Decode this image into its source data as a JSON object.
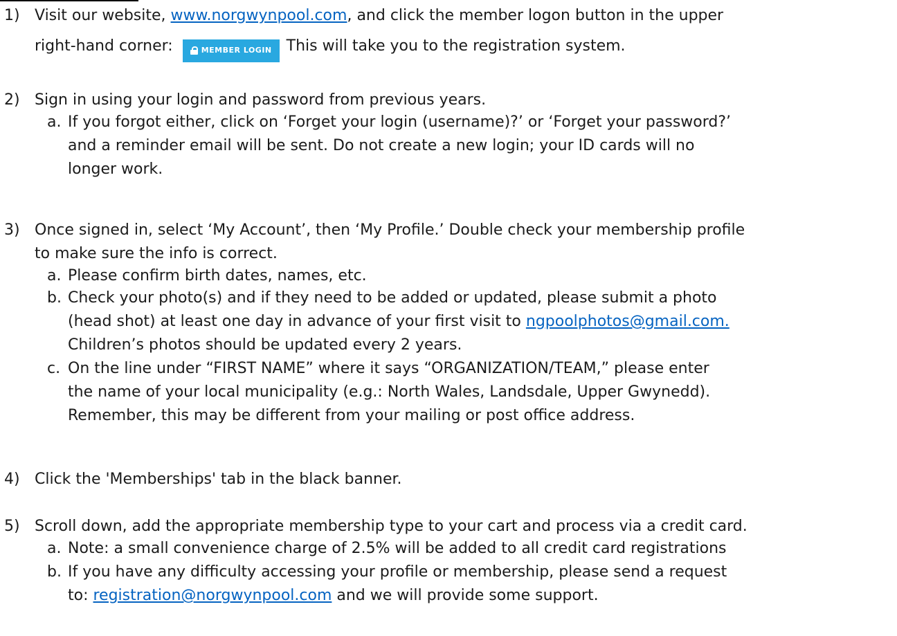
{
  "steps": [
    {
      "num": "1)",
      "line1_a": "Visit our website, ",
      "link": "www.norgwynpool.com",
      "line1_b": ", and click the member logon button in the upper",
      "line2_a": "right-hand corner:",
      "button_label": "MEMBER LOGIN",
      "line2_b": "This will take you to the registration system."
    },
    {
      "num": "2)",
      "text": "Sign in using your login and password from previous years.",
      "subs": [
        {
          "letter": "a.",
          "l1": "If you forgot either, click on ‘Forget your login (username)?’ or ‘Forget your password?’",
          "l2": "and a reminder email will be sent.  Do not create a new login; your ID cards will no",
          "l3": "longer work."
        }
      ]
    },
    {
      "num": "3)",
      "l1": "Once signed in, select ‘My Account’, then ‘My Profile.’  Double check your membership profile",
      "l2": "to make sure the info is correct.",
      "subs": [
        {
          "letter": "a.",
          "l1": "Please confirm birth dates, names, etc."
        },
        {
          "letter": "b.",
          "l1": "Check your photo(s) and if they need to be added or updated, please submit a photo",
          "l2a": "(head shot) at least one day in advance of your first visit to ",
          "link": "ngpoolphotos@gmail.com.",
          "l3": "Children’s photos should be updated every 2 years."
        },
        {
          "letter": "c.",
          "l1": "On the line under “FIRST NAME” where it says “ORGANIZATION/TEAM,” please enter",
          "l2": "the name of your local municipality (e.g.: North Wales, Landsdale, Upper Gwynedd).",
          "l3": "Remember, this may be different from your mailing or post office address."
        }
      ]
    },
    {
      "num": "4)",
      "text": "Click the 'Memberships' tab in the black banner."
    },
    {
      "num": "5)",
      "text": "Scroll down, add the appropriate membership type to your cart and process via a credit card.",
      "subs": [
        {
          "letter": "a.",
          "l1": "Note: a small convenience charge of 2.5% will be added to all credit card registrations"
        },
        {
          "letter": "b.",
          "l1": "If you have any difficulty accessing your profile or membership, please send a request",
          "l2a": "to: ",
          "link": "registration@norgwynpool.com",
          "l2b": " and we will provide some support."
        }
      ]
    }
  ],
  "icons": {
    "login_button_icon": "lock-icon"
  },
  "colors": {
    "link": "#0563c1",
    "button_bg": "#29a8e0",
    "button_text": "#ffffff"
  }
}
